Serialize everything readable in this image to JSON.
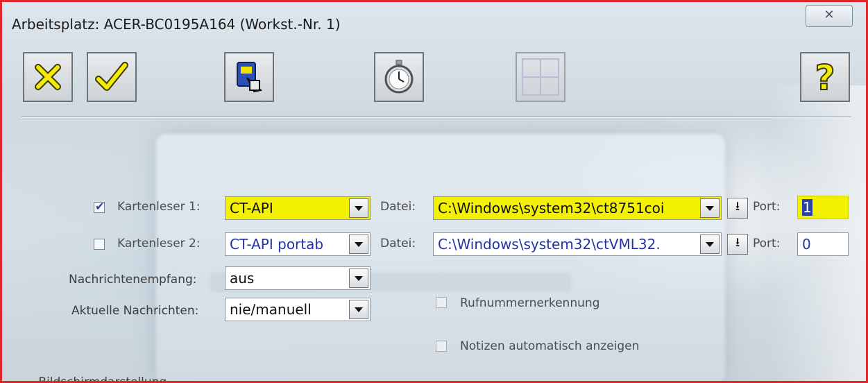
{
  "window": {
    "title": "Arbeitsplatz: ACER-BC0195A164 (Workst.-Nr.   1)",
    "close_glyph": "✕"
  },
  "toolbar": {
    "cancel": "cancel-icon",
    "ok": "checkmark-icon",
    "settings": "card-reader-icon",
    "timer": "stopwatch-icon",
    "grid": "grid-icon",
    "help": "help-question-icon"
  },
  "reader1": {
    "checked": true,
    "label": "Kartenleser 1:",
    "type": "CT-API",
    "file_label": "Datei:",
    "file": "C:\\Windows\\system32\\ct8751coi",
    "port_label": "Port:",
    "port": "1"
  },
  "reader2": {
    "checked": false,
    "label": "Kartenleser 2:",
    "type": "CT-API portab",
    "file_label": "Datei:",
    "file": "C:\\Windows\\system32\\ctVML32.",
    "port_label": "Port:",
    "port": "0"
  },
  "messages": {
    "receive_label": "Nachrichtenempfang:",
    "receive_value": "aus",
    "current_label": "Aktuelle Nachrichten:",
    "current_value": "nie/manuell"
  },
  "options": {
    "caller_id": "Rufnummernerkennung",
    "notes_auto": "Notizen automatisch anzeigen"
  },
  "groups": {
    "display": "Bildschirmdarstellung"
  },
  "colors": {
    "highlight": "#f2f200",
    "border": "#e0262b",
    "value_text": "#2233aa"
  }
}
